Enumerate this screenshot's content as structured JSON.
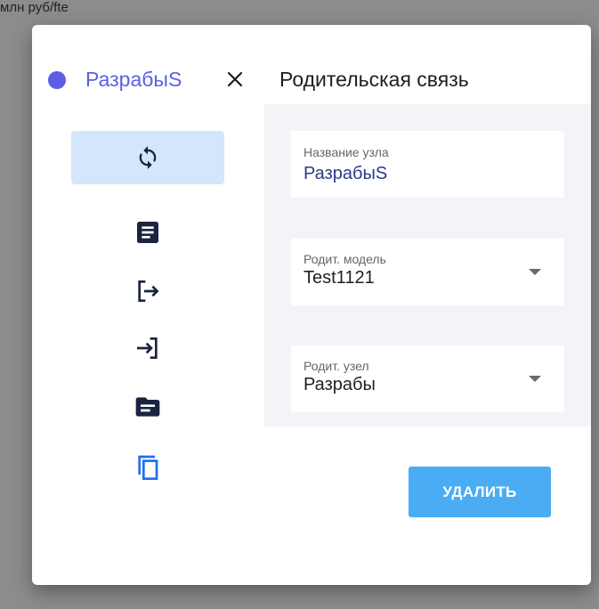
{
  "background": {
    "text": "млн руб/fte"
  },
  "dialog": {
    "node_title": "РазрабыS",
    "header_title": "Родительская связь",
    "accent_color": "#5b5fe6",
    "sidebar": {
      "items": [
        {
          "icon": "sync-icon",
          "active": true
        },
        {
          "icon": "document-icon",
          "active": false
        },
        {
          "icon": "logout-icon",
          "active": false
        },
        {
          "icon": "login-icon",
          "active": false
        },
        {
          "icon": "folder-icon",
          "active": false
        },
        {
          "icon": "copy-icon",
          "active": false
        }
      ]
    },
    "fields": {
      "node_name": {
        "label": "Название узла",
        "value": "РазрабыS"
      },
      "parent_model": {
        "label": "Родит. модель",
        "value": "Test1121"
      },
      "parent_node": {
        "label": "Родит. узел",
        "value": "Разрабы"
      }
    },
    "delete_label": "УДАЛИТЬ",
    "delete_color": "#4aacf3"
  }
}
